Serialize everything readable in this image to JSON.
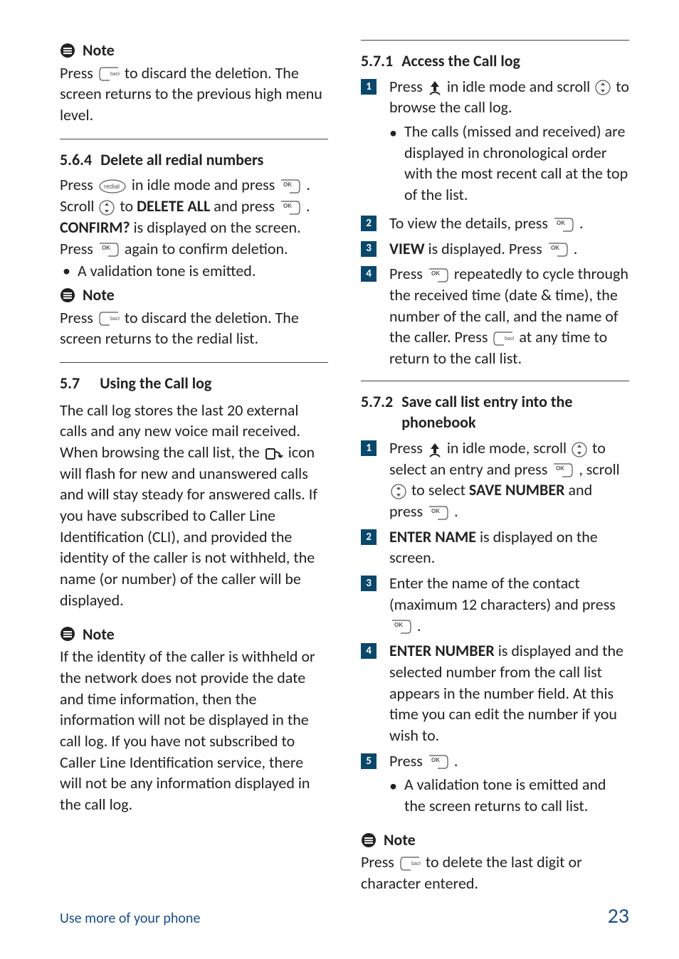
{
  "left": {
    "note1_title": "Note",
    "note1_body_a": "Press ",
    "note1_body_b": " to discard the deletion. The screen returns to the previous high menu level.",
    "s564_num": "5.6.4",
    "s564_title": "Delete all redial numbers",
    "s564_p1a": "Press ",
    "s564_p1b": " in idle mode and press ",
    "s564_p1c": ". Scroll ",
    "s564_p1d": " to ",
    "s564_delall": "DELETE ALL",
    "s564_p1e": " and press ",
    "s564_p1f": ".",
    "s564_confirm": "CONFIRM?",
    "s564_p2a": " is displayed on the screen. Press ",
    "s564_p2b": " again to confirm deletion.",
    "s564_bullet": "A validation tone is emitted.",
    "note2_title": "Note",
    "note2_body_a": "Press ",
    "note2_body_b": " to discard the deletion. The screen returns to the redial list.",
    "s57_num": "5.7",
    "s57_title": "Using the Call log",
    "s57_p1a": "The call log stores the last 20 external calls and any new voice mail received. When browsing the call list, the ",
    "s57_p1b": " icon will flash for new and unanswered calls and will stay steady for answered calls. If you have subscribed to Caller Line Identification (CLI), and provided the identity of the caller is not withheld, the name (or number) of the caller will be displayed.",
    "note3_title": "Note",
    "note3_body": "If the identity of the caller is withheld or the network does not provide the date and time information, then the information will not be displayed in the call log. If you have not subscribed to Caller Line Identification service, there will not be any information displayed in the call log."
  },
  "right": {
    "s571_num": "5.7.1",
    "s571_title": "Access the Call log",
    "steps571": [
      {
        "n": "1",
        "a": "Press ",
        "b": " in idle mode and scroll ",
        "c": " to browse the call log.",
        "sub": "The calls (missed and received) are displayed in chronological order with the most recent call at the top of the list."
      },
      {
        "n": "2",
        "a": "To view the details, press ",
        "b": "."
      },
      {
        "n": "3",
        "label": "VIEW",
        "a": " is displayed. Press ",
        "b": "."
      },
      {
        "n": "4",
        "a": "Press ",
        "b": " repeatedly to cycle through the received time (date & time), the number of the call, and the name of the caller. Press ",
        "c": " at any time to return to the call list."
      }
    ],
    "s572_num": "5.7.2",
    "s572_title": "Save call list entry into the phonebook",
    "steps572": [
      {
        "n": "1",
        "a": "Press ",
        "b": " in idle mode, scroll ",
        "c": " to select an entry and press ",
        "d": ", scroll ",
        "e": " to select ",
        "label": "SAVE NUMBER",
        "f": " and press ",
        "g": "."
      },
      {
        "n": "2",
        "label": "ENTER NAME",
        "a": " is displayed on the screen."
      },
      {
        "n": "3",
        "a": "Enter the name of the contact (maximum 12 characters) and press ",
        "b": "."
      },
      {
        "n": "4",
        "label": "ENTER NUMBER",
        "a": " is displayed and the selected number from the call list appears in the number field. At this time you can edit the number if you wish to."
      },
      {
        "n": "5",
        "a": "Press ",
        "b": ".",
        "sub": "A validation tone is emitted and the screen returns to call list."
      }
    ],
    "note4_title": "Note",
    "note4_a": "Press ",
    "note4_b": " to delete the last digit or character entered."
  },
  "footer": {
    "left": "Use more of your phone",
    "right": "23"
  }
}
